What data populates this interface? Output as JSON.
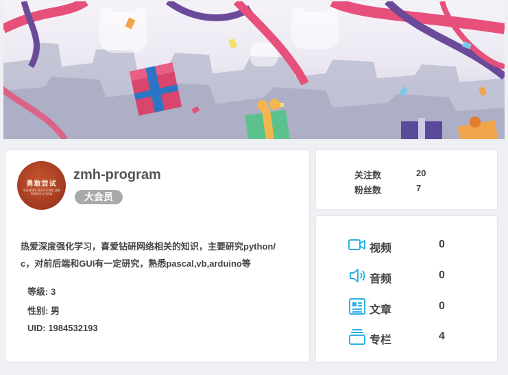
{
  "profile": {
    "avatar_text": "勇敢尝试",
    "avatar_subtext": "学而思则罔 思而不学则殆 温故而知新可以为师矣",
    "username": "zmh-program",
    "vip_badge": "大会员",
    "bio": "热爱深度强化学习，喜爱钻研网络相关的知识，主要研究python/c，对前后端和GUI有一定研究，熟悉pascal,vb,arduino等",
    "level": "等级: 3",
    "gender": "性别: 男",
    "uid": "UID: 1984532193"
  },
  "follow": {
    "following_label": "关注数",
    "following_value": "20",
    "fans_label": "粉丝数",
    "fans_value": "7"
  },
  "stats": [
    {
      "label": "视频",
      "value": "0",
      "icon": "video-icon"
    },
    {
      "label": "音频",
      "value": "0",
      "icon": "audio-icon"
    },
    {
      "label": "文章",
      "value": "0",
      "icon": "article-icon"
    },
    {
      "label": "专栏",
      "value": "4",
      "icon": "column-icon"
    }
  ],
  "colors": {
    "accent_icon": "#2bb1e6",
    "vip_badge_bg": "#a9a9a9",
    "ribbon_pink": "#e6507a",
    "ribbon_purple": "#6b4a9a"
  }
}
